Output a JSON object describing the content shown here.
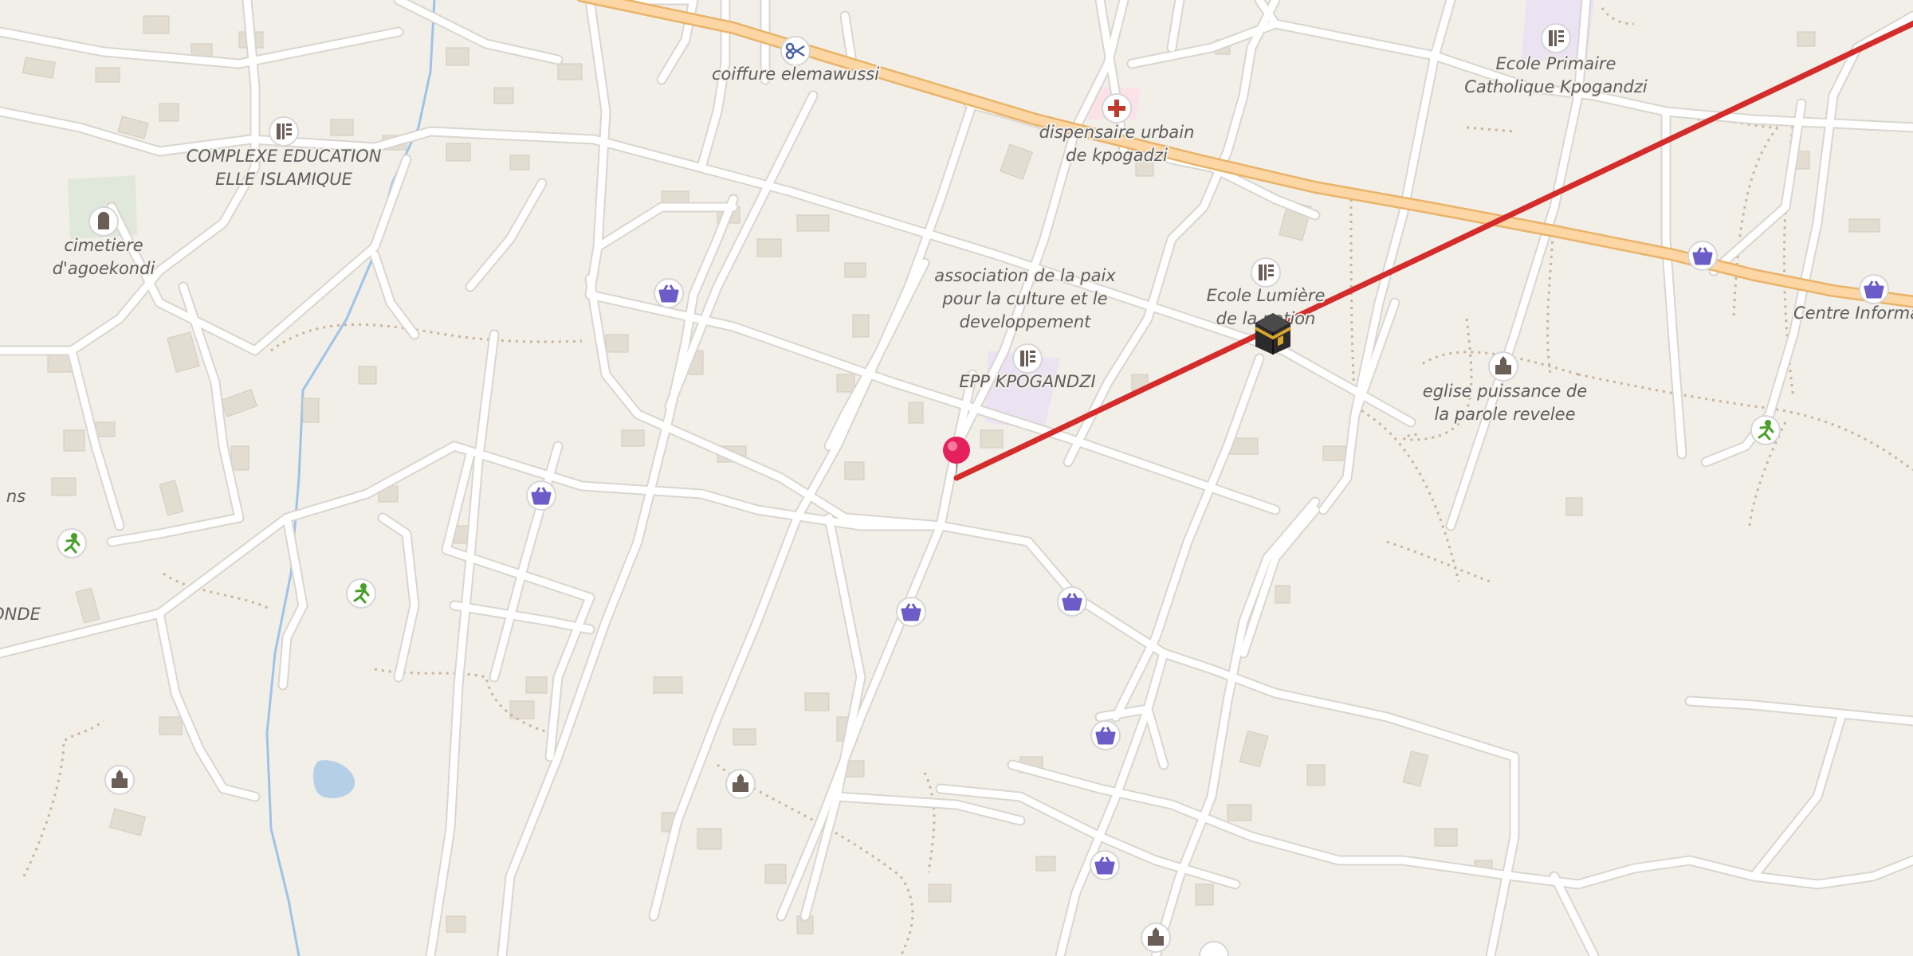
{
  "map": {
    "labels": {
      "coiffure": "coiffure elemawussi",
      "dispensaire_1": "dispensaire urbain",
      "dispensaire_2": "de kpogadzi",
      "complexe_1": "COMPLEXE EDUCATION",
      "complexe_2": "ELLE ISLAMIQUE",
      "cimetiere_1": "cimetiere",
      "cimetiere_2": "d'agoekondi",
      "association_1": "association de la paix",
      "association_2": "pour la culture et le",
      "association_3": "developpement",
      "epp": "EPP KPOGANDZI",
      "ecole_lumiere_1": "Ecole Lumière",
      "ecole_lumiere_2": "de la nation",
      "ecole_primaire_1": "Ecole Primaire",
      "ecole_primaire_2": "Catholique Kpogandzi",
      "eglise_1": "eglise puissance de",
      "eglise_2": "la parole revelee",
      "centre": "Centre Informa",
      "partial_ns": "ns",
      "partial_onde": "ONDE"
    },
    "icons": {
      "shop": "shopping-basket-icon",
      "school": "school-icon",
      "worship": "place-of-worship-icon",
      "sport": "sports-icon",
      "health": "first-aid-icon",
      "hairdresser": "scissors-icon",
      "cemetery": "cemetery-icon",
      "kaaba": "kaaba-icon",
      "pin": "location-pin-icon"
    },
    "colors": {
      "background": "#f2efe9",
      "road": "#ffffff",
      "road_casing": "#d9d5cf",
      "primary_road": "#fcd6a4",
      "primary_casing": "#e9b46a",
      "water": "#9fc3e7",
      "qibla_line": "#d42b2b",
      "shop_icon": "#6b5cc7",
      "school_area": "#ebe3f2",
      "cemetery_area": "#dfe8da"
    }
  }
}
